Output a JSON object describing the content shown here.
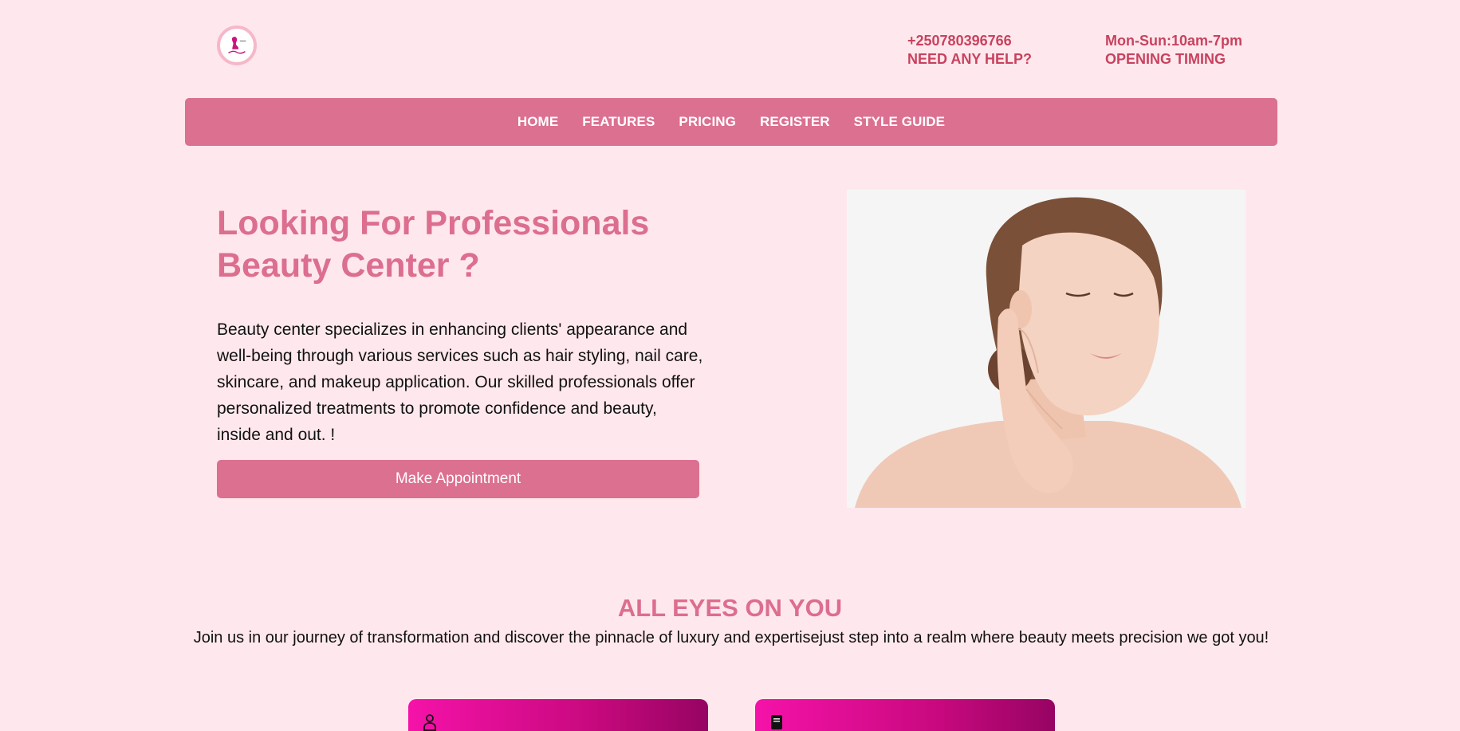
{
  "header": {
    "logo_icon": "beauty-logo-icon",
    "phone": "+250780396766",
    "help_label": "NEED ANY HELP?",
    "hours": "Mon-Sun:10am-7pm",
    "hours_label": "OPENING TIMING"
  },
  "nav": {
    "items": [
      {
        "label": "HOME"
      },
      {
        "label": "FEATURES"
      },
      {
        "label": "PRICING"
      },
      {
        "label": "REGISTER"
      },
      {
        "label": "STYLE GUIDE"
      }
    ]
  },
  "hero": {
    "title": "Looking For Professionals Beauty Center ?",
    "description": "Beauty center specializes in enhancing clients' appearance and well-being through various services such as hair styling, nail care, skincare, and makeup application. Our skilled professionals offer personalized treatments to promote confidence and beauty, inside and out. !",
    "cta_label": "Make Appointment",
    "image_icon": "woman-skincare-photo"
  },
  "section": {
    "title": "ALL EYES ON YOU",
    "text": "Join us in our journey of transformation and discover the pinnacle of luxury and expertisejust step into a realm where beauty meets precision we got you!"
  },
  "cards": [
    {
      "icon": "person-icon"
    },
    {
      "icon": "book-icon"
    }
  ],
  "colors": {
    "background": "#ffe8ed",
    "accent": "#dc7090",
    "heading": "#dc6e8f",
    "contact_text": "#c8425f",
    "card_gradient_start": "#f512a9",
    "card_gradient_end": "#960462"
  }
}
